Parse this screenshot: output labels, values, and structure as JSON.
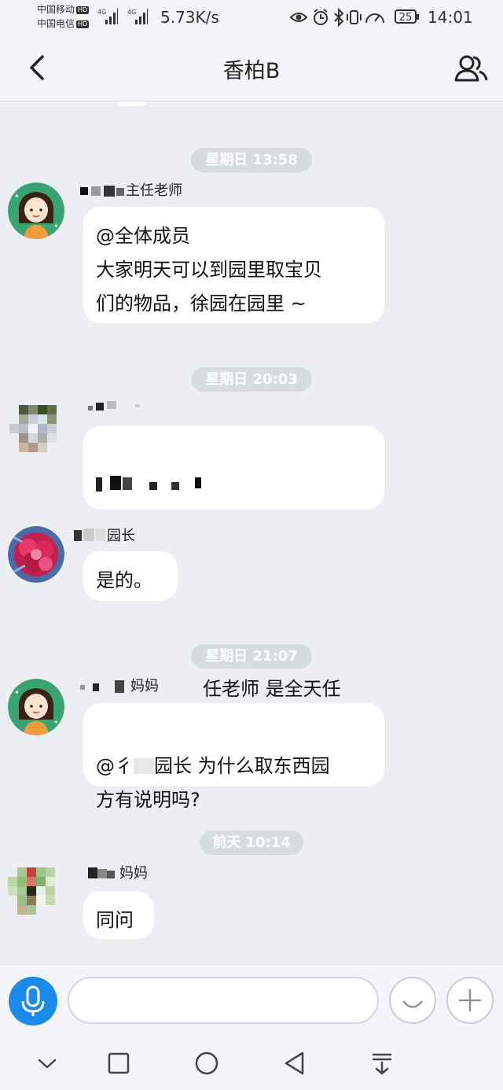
{
  "status_bar": {
    "carrier1": "中国移动",
    "carrier2": "中国电信",
    "hd_badge": "HD",
    "net_label": "4G",
    "speed": "5.73K/s",
    "battery": "25",
    "time": "14:01"
  },
  "header": {
    "title": "香柏B",
    "back_icon": "chevron-left-icon",
    "members_icon": "group-members-icon"
  },
  "messages": [
    {
      "time_chip": "星期日 13:58",
      "sender": "主任老师",
      "text": "@全体成员\n大家明天可以到园里取宝贝\n们的物品，徐园在园里 ~",
      "avatar": "cartoon-girl"
    },
    {
      "time_chip": "星期日 20:03",
      "sender": "",
      "text": "任老师 是全天任\n何时间都可以吗",
      "avatar": "blurred-photo"
    },
    {
      "time_chip": "",
      "sender": "园长",
      "text": "是的。",
      "avatar": "red-flower-photo"
    },
    {
      "time_chip": "星期日 21:07",
      "sender": "妈妈",
      "text": "园长 为什么取东西园\n方有说明吗?",
      "text_prefix": "@彳",
      "avatar": "cartoon-girl"
    },
    {
      "time_chip": "前天 10:14",
      "sender": "妈妈",
      "text": "同问",
      "avatar": "blurred-photo-green"
    }
  ],
  "input_bar": {
    "mic_icon": "microphone-icon",
    "emoji_icon": "smiley-icon",
    "plus_icon": "plus-icon",
    "message_value": ""
  },
  "system_nav": {
    "icons": [
      "collapse-down-icon",
      "recents-square-icon",
      "home-circle-icon",
      "back-triangle-icon",
      "notification-pull-icon"
    ]
  }
}
